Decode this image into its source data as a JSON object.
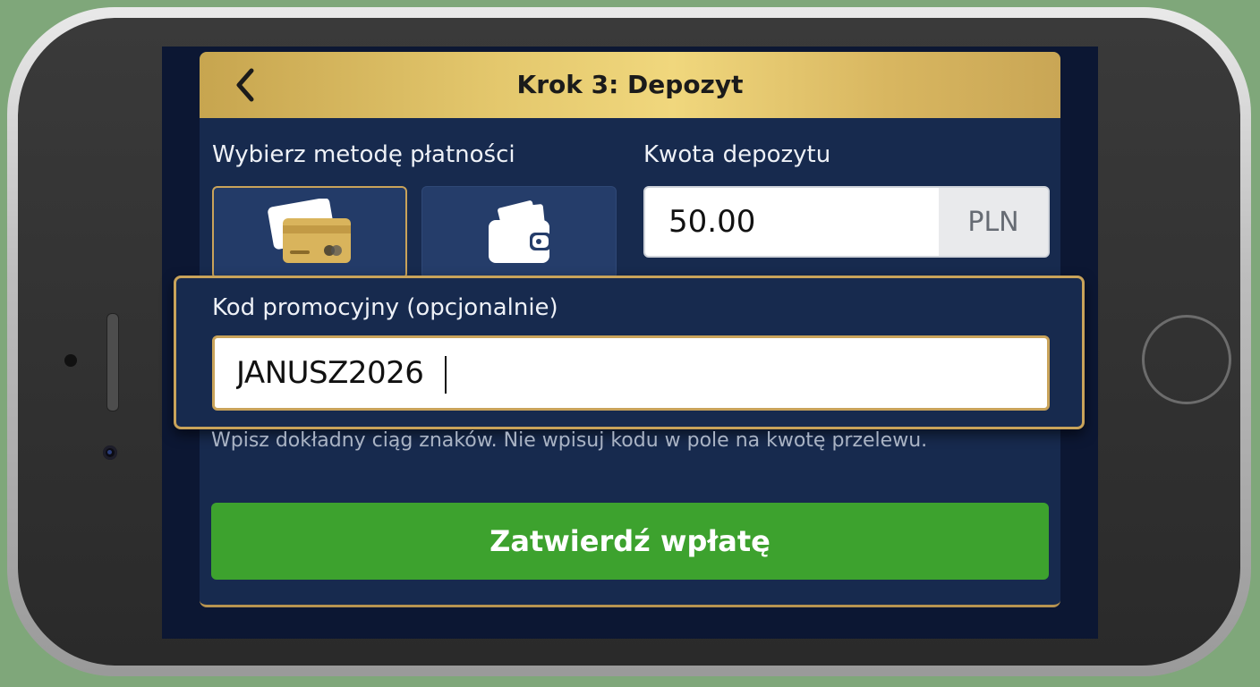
{
  "header": {
    "title": "Krok 3: Depozyt",
    "back_icon": "chevron-left-icon"
  },
  "payment": {
    "label": "Wybierz metodę płatności",
    "methods": [
      {
        "icon": "credit-card-icon",
        "selected": true
      },
      {
        "icon": "wallet-icon",
        "selected": false
      }
    ]
  },
  "amount": {
    "label": "Kwota depozytu",
    "value": "50.00",
    "currency": "PLN"
  },
  "promo": {
    "label": "Kod promocyjny (opcjonalnie)",
    "value": "JANUSZ2026"
  },
  "hint": "Wpisz dokładny ciąg znaków. Nie wpisuj kodu w pole na kwotę przelewu.",
  "submit": {
    "label": "Zatwierdź wpłatę"
  },
  "colors": {
    "gold": "#c9a35a",
    "panel": "#172a4e",
    "background": "#0c1733",
    "submit": "#3da22e"
  }
}
